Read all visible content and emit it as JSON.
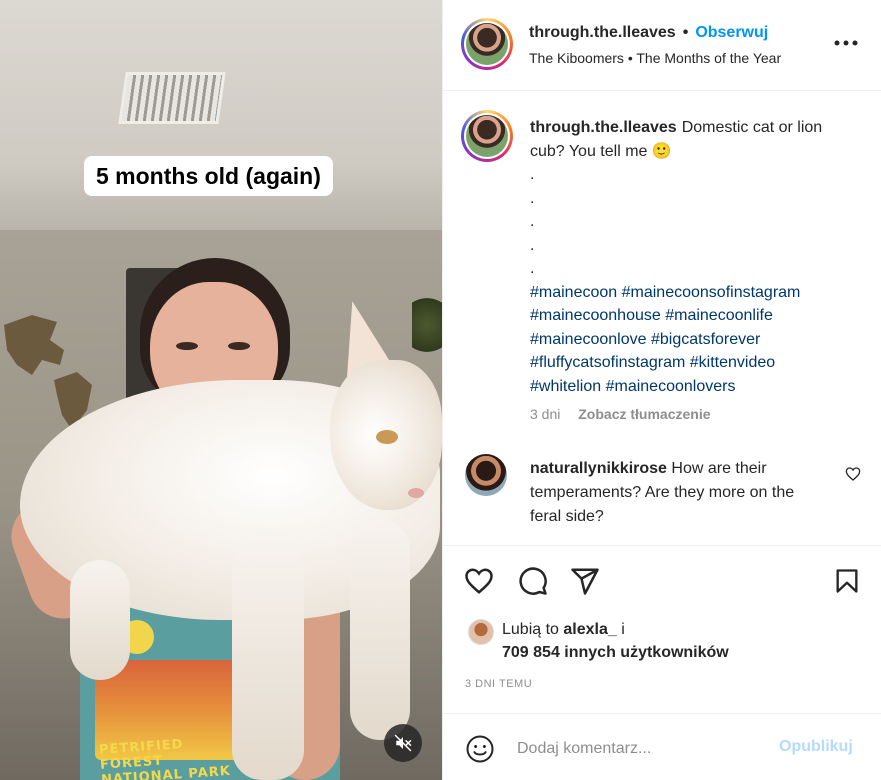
{
  "media": {
    "overlay_caption": "5 months old (again)",
    "shirt_print": "PETRIFIED FOREST NATIONAL PARK",
    "mute_icon": "speaker-muted-icon"
  },
  "header": {
    "username": "through.the.lleaves",
    "separator": "•",
    "follow_label": "Obserwuj",
    "audio": "The Kiboomers • The Months of the Year",
    "more_icon": "more-horizontal-icon"
  },
  "caption": {
    "username": "through.the.lleaves",
    "text": "Domestic cat or lion cub? You tell me 🙂",
    "dots": [
      ".",
      ".",
      ".",
      ".",
      "."
    ],
    "hashtags": "#mainecoon #mainecoonsofinstagram #mainecoonhouse #mainecoonlife #mainecoonlove #bigcatsforever #fluffycatsofinstagram #kittenvideo #whitelion #mainecoonlovers",
    "age": "3 dni",
    "translate_label": "Zobacz tłumaczenie"
  },
  "comment": {
    "username": "naturallynikkirose",
    "text": "How are their temperaments? Are they more on the feral side?"
  },
  "actions": {
    "icons": [
      "heart-icon",
      "comment-icon",
      "share-icon",
      "bookmark-icon"
    ],
    "likes_prefix": "Lubią to",
    "likes_user": "alexla_",
    "likes_suffix": "i",
    "likes_others": "709 854 innych użytkowników",
    "date": "3 DNI TEMU"
  },
  "add_comment": {
    "placeholder": "Dodaj komentarz...",
    "publish_label": "Opublikuj"
  },
  "colors": {
    "link_blue": "#0095f6",
    "hashtag_blue": "#00376b",
    "publish_disabled": "#b3dbff",
    "muted_text": "#8e8e8e"
  }
}
